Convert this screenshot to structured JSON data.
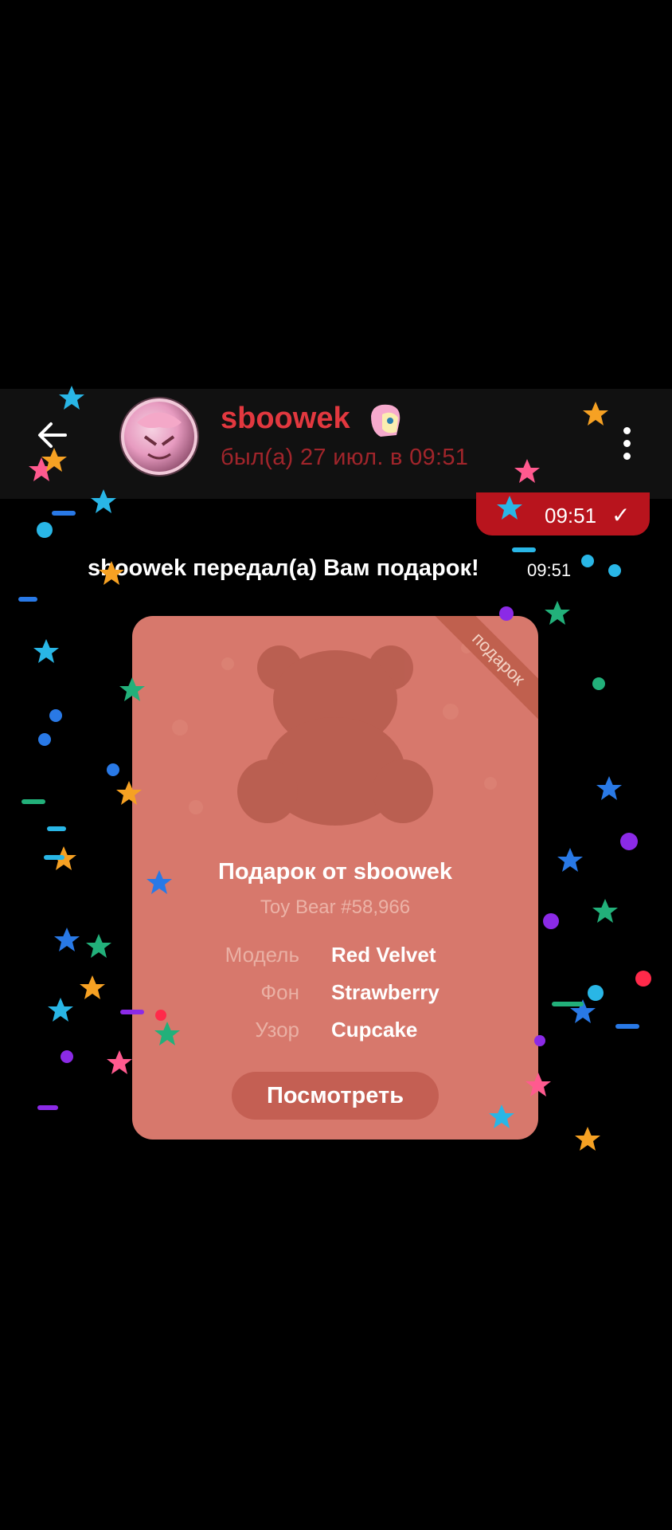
{
  "header": {
    "contact_name": "sboowek",
    "status": "был(а) 27 июл. в 09:51",
    "icons": [
      "back-arrow-icon",
      "pony-emoji-icon",
      "more-vertical-icon"
    ]
  },
  "outgoing_message": {
    "time": "09:51",
    "status_icon": "check-icon"
  },
  "service_message": {
    "text": "sboowek передал(а) Вам подарок!",
    "time": "09:51"
  },
  "gift": {
    "ribbon": "подарок",
    "title": "Подарок от sboowek",
    "subtitle": "Toy Bear #58,966",
    "attributes": [
      {
        "label": "Модель",
        "value": "Red Velvet"
      },
      {
        "label": "Фон",
        "value": "Strawberry"
      },
      {
        "label": "Узор",
        "value": "Cupcake"
      }
    ],
    "view_button": "Посмотреть",
    "background_color": "#d7786c"
  },
  "colors": {
    "accent": "#e2383f",
    "bubble": "#b8141d"
  }
}
